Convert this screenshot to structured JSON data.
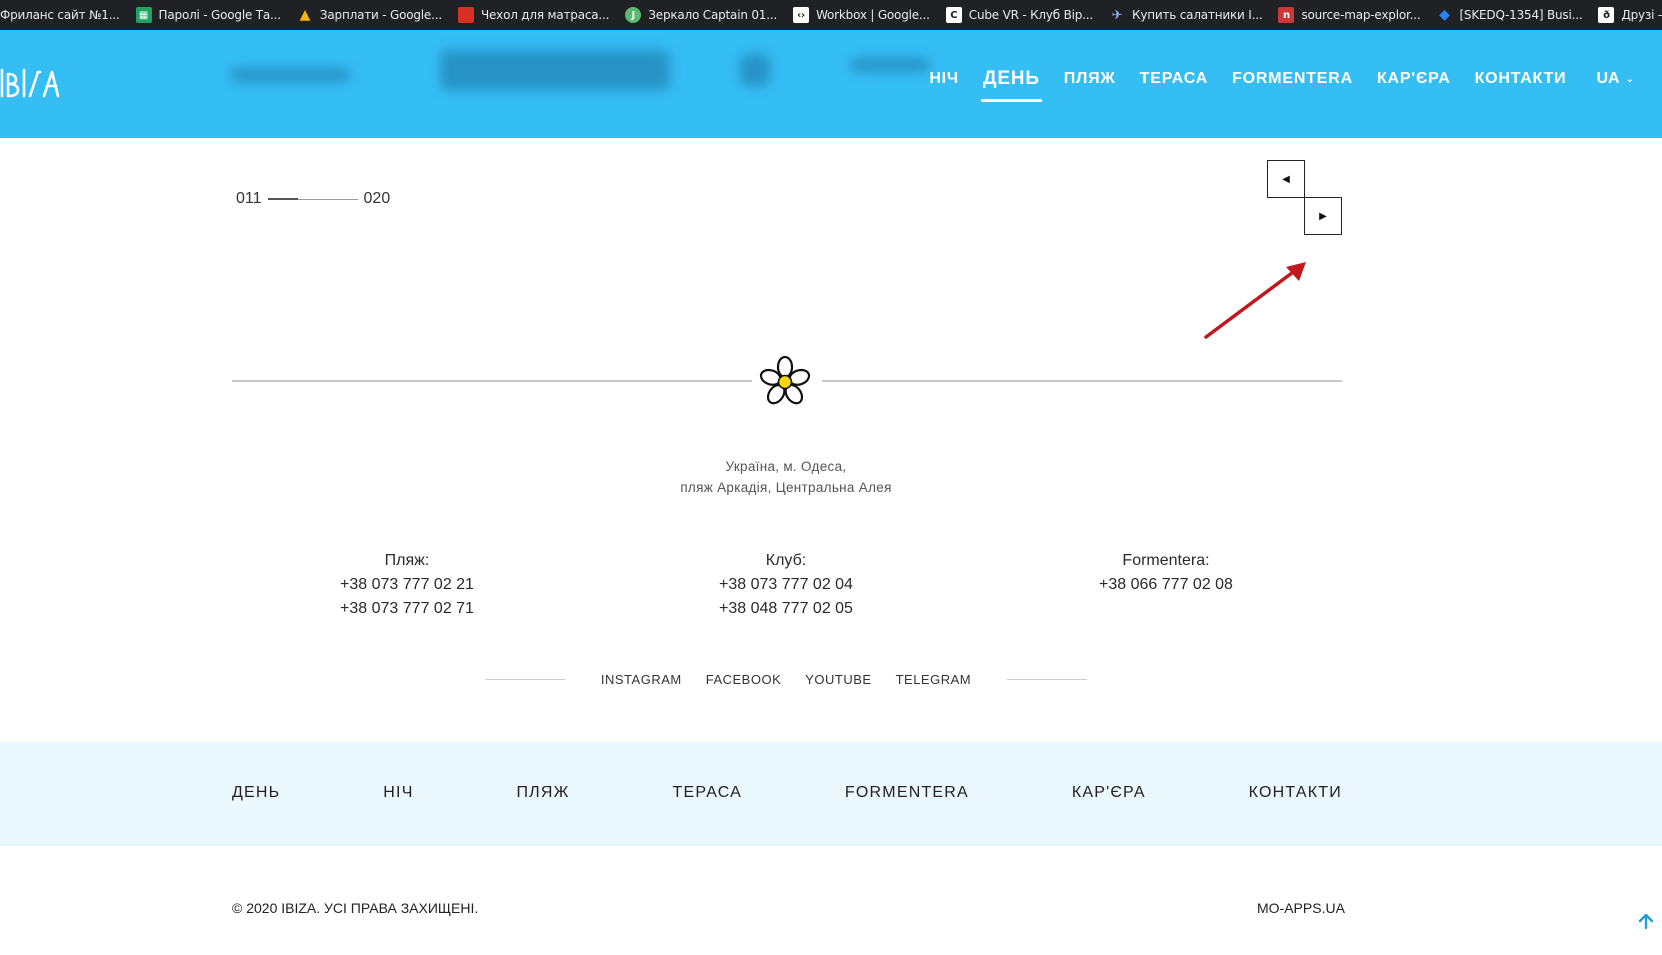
{
  "bookmarks": [
    {
      "label": "Фриланс сайт №1...",
      "icon": "freelance-icon",
      "color": "#202124"
    },
    {
      "label": "Паролі - Google Та...",
      "icon": "sheets-icon",
      "color": "#1fa463"
    },
    {
      "label": "Зарплати - Google...",
      "icon": "drive-icon",
      "color": "#f4b400"
    },
    {
      "label": "Чехол для матраса...",
      "icon": "folder-icon",
      "color": "#d93025"
    },
    {
      "label": "Зеркало Captain 01...",
      "icon": "captain-icon",
      "color": "#5bb974"
    },
    {
      "label": "Workbox | Google...",
      "icon": "workbox-icon",
      "color": "#ffffff"
    },
    {
      "label": "Cube VR - Клуб Вір...",
      "icon": "cube-icon",
      "color": "#ffffff"
    },
    {
      "label": "Купить салатники I...",
      "icon": "bird-icon",
      "color": "#8ab4f8"
    },
    {
      "label": "source-map-explor...",
      "icon": "npm-icon",
      "color": "#cb3837"
    },
    {
      "label": "[SKEDQ-1354] Busi...",
      "icon": "jira-icon",
      "color": "#2684ff"
    },
    {
      "label": "Друзі - це сім'я, як...",
      "icon": "page-icon",
      "color": "#ffffff"
    }
  ],
  "header": {
    "logo_alt": "IBIZA",
    "nav": [
      {
        "label": "НІЧ",
        "active": false
      },
      {
        "label": "ДЕНЬ",
        "active": true
      },
      {
        "label": "ПЛЯЖ",
        "active": false
      },
      {
        "label": "ТЕРАСА",
        "active": false
      },
      {
        "label": "FORMENTERA",
        "active": false
      },
      {
        "label": "КАР'ЄРА",
        "active": false
      },
      {
        "label": "КОНТАКТИ",
        "active": false
      }
    ],
    "lang": "UA",
    "bg_color": "#35bef4"
  },
  "pager": {
    "from": "011",
    "to": "020"
  },
  "address": {
    "line1": "Україна, м. Одеса,",
    "line2": "пляж Аркадія, Центральна Алея"
  },
  "contacts": [
    {
      "title": "Пляж:",
      "phones": [
        "+38 073 777 02 21",
        "+38 073 777 02 71"
      ]
    },
    {
      "title": "Клуб:",
      "phones": [
        "+38 073 777 02 04",
        "+38 048 777 02 05"
      ]
    },
    {
      "title": "Formentera:",
      "phones": [
        "+38 066 777 02 08"
      ]
    }
  ],
  "social": [
    "INSTAGRAM",
    "FACEBOOK",
    "YOUTUBE",
    "TELEGRAM"
  ],
  "footer_nav": [
    "ДЕНЬ",
    "НІЧ",
    "ПЛЯЖ",
    "ТЕРАСА",
    "FORMENTERA",
    "КАР'ЄРА",
    "КОНТАКТИ"
  ],
  "copyright": "© 2020 IBIZA. УСІ ПРАВА ЗАХИЩЕНІ.",
  "credit": "MO-APPS.UA",
  "colors": {
    "accent": "#35bef4",
    "footer_bg": "#eaf7fc",
    "annotation": "#c0181e"
  }
}
